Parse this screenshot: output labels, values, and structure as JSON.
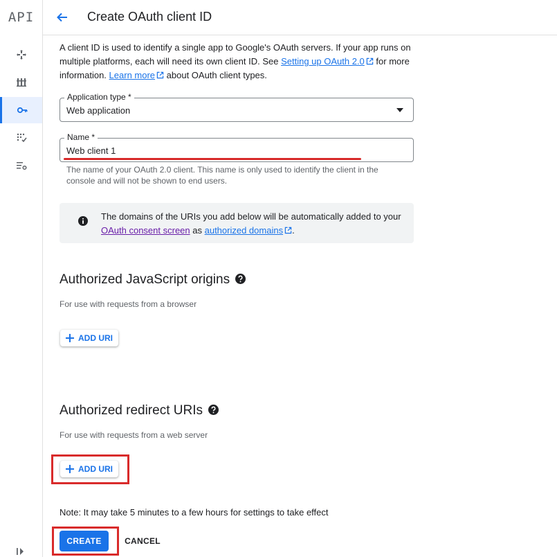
{
  "rail": {
    "logo": "API",
    "items": [
      {
        "icon": "dashboard-icon"
      },
      {
        "icon": "library-icon"
      },
      {
        "icon": "key-icon",
        "active": true
      },
      {
        "icon": "consent-icon"
      },
      {
        "icon": "settings-list-icon"
      }
    ],
    "expand_icon": "expand-rail-icon"
  },
  "header": {
    "title": "Create OAuth client ID"
  },
  "intro": {
    "part1": "A client ID is used to identify a single app to Google's OAuth servers. If your app runs on multiple platforms, each will need its own client ID. See ",
    "link1": "Setting up OAuth 2.0",
    "part2": " for more information. ",
    "link2": "Learn more",
    "part3": " about OAuth client types."
  },
  "application_type": {
    "label": "Application type *",
    "value": "Web application"
  },
  "name_field": {
    "label": "Name *",
    "value": "Web client 1",
    "helper": "The name of your OAuth 2.0 client. This name is only used to identify the client in the console and will not be shown to end users."
  },
  "info": {
    "text1": "The domains of the URIs you add below will be automatically added to your ",
    "link1": "OAuth consent screen",
    "text2": " as ",
    "link2": "authorized domains",
    "text3": "."
  },
  "js_origins": {
    "title": "Authorized JavaScript origins",
    "subtitle": "For use with requests from a browser",
    "add_label": "ADD URI"
  },
  "redirect_uris": {
    "title": "Authorized redirect URIs",
    "subtitle": "For use with requests from a web server",
    "add_label": "ADD URI"
  },
  "note": "Note: It may take 5 minutes to a few hours for settings to take effect",
  "actions": {
    "create": "CREATE",
    "cancel": "CANCEL"
  },
  "colors": {
    "accent": "#1a73e8",
    "highlight": "#d92b2b",
    "visited_link": "#681da8"
  }
}
